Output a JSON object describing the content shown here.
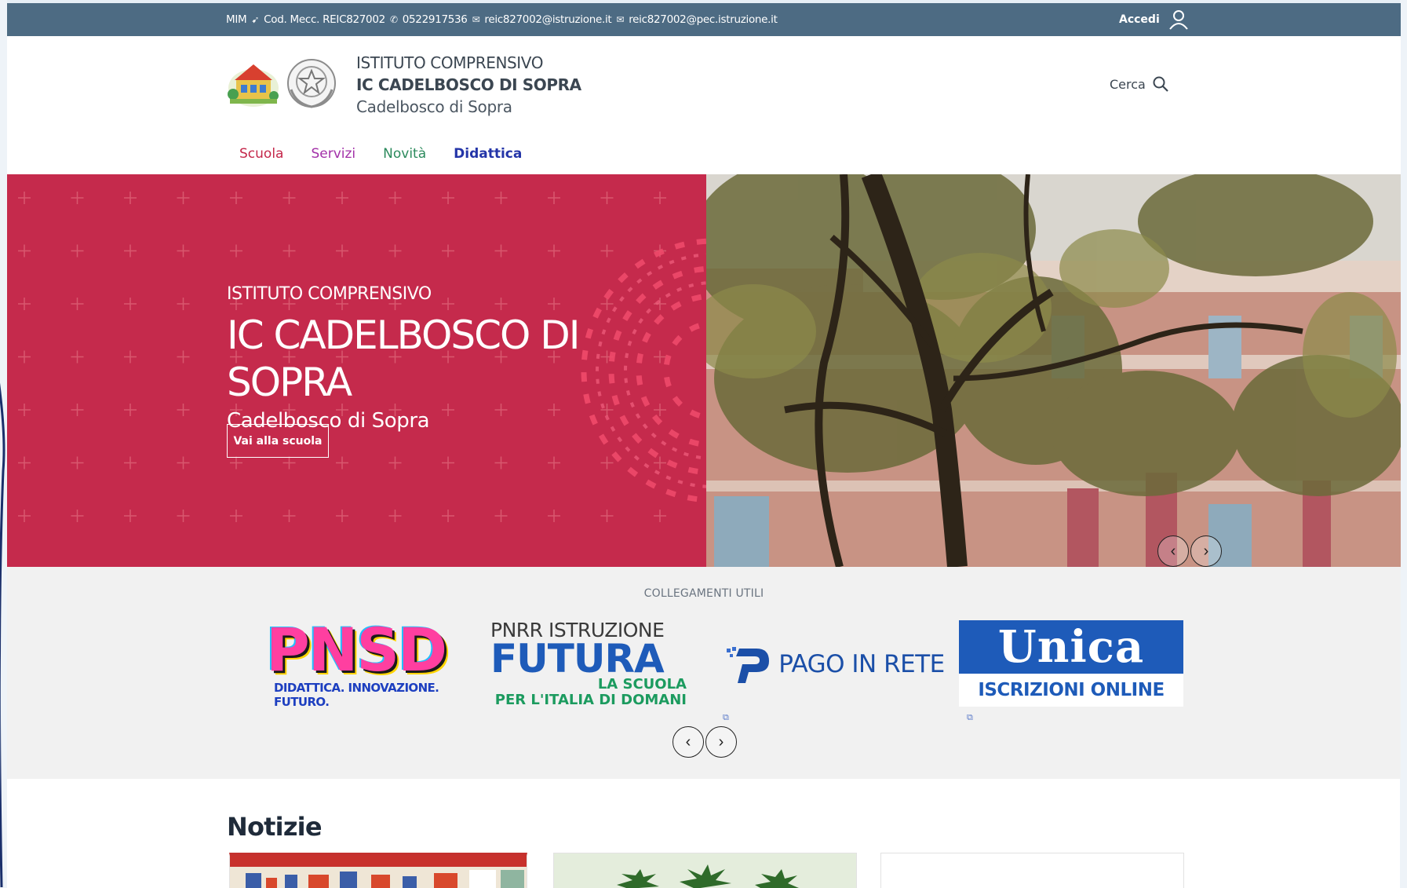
{
  "topbar": {
    "ministry": "MIM",
    "mecc_code": "Cod. Mecc. REIC827002",
    "phone": "0522917536",
    "email": "reic827002@istruzione.it",
    "pec": "reic827002@pec.istruzione.it",
    "login_label": "Accedi"
  },
  "header": {
    "line1": "ISTITUTO COMPRENSIVO",
    "line2": "IC CADELBOSCO DI SOPRA",
    "line3": "Cadelbosco di Sopra",
    "search_label": "Cerca"
  },
  "nav": {
    "items": [
      "Scuola",
      "Servizi",
      "Novità",
      "Didattica"
    ]
  },
  "hero": {
    "overline": "ISTITUTO COMPRENSIVO",
    "title": "IC CADELBOSCO DI SOPRA",
    "subtitle": "Cadelbosco di Sopra",
    "button_label": "Vai alla scuola",
    "prev_label": "‹",
    "next_label": "›"
  },
  "links": {
    "title": "COLLEGAMENTI UTILI",
    "pnsd": {
      "big": "PNSD",
      "small": "DIDATTICA. INNOVAZIONE. FUTURO."
    },
    "futura": {
      "line1": "PNRR ISTRUZIONE",
      "line2": "FUTURA",
      "line3": "LA SCUOLA",
      "line4": "PER L'ITALIA DI DOMANI"
    },
    "pago": {
      "text": "PAGO IN RETE"
    },
    "unica": {
      "brand": "Unica",
      "sub": "ISCRIZIONI ONLINE"
    },
    "prev_label": "‹",
    "next_label": "›"
  },
  "news": {
    "title": "Notizie"
  },
  "colors": {
    "topbar": "#4d6b83",
    "hero_red": "#c52a4c",
    "nav_scuola": "#c4274a",
    "nav_servizi": "#a230a8",
    "nav_novita": "#2b8a5c",
    "nav_didattica": "#2435a8"
  },
  "icons": [
    "phone-icon",
    "mail-icon",
    "user-icon",
    "search-icon",
    "school-logo",
    "republic-emblem",
    "external-link-icon"
  ]
}
